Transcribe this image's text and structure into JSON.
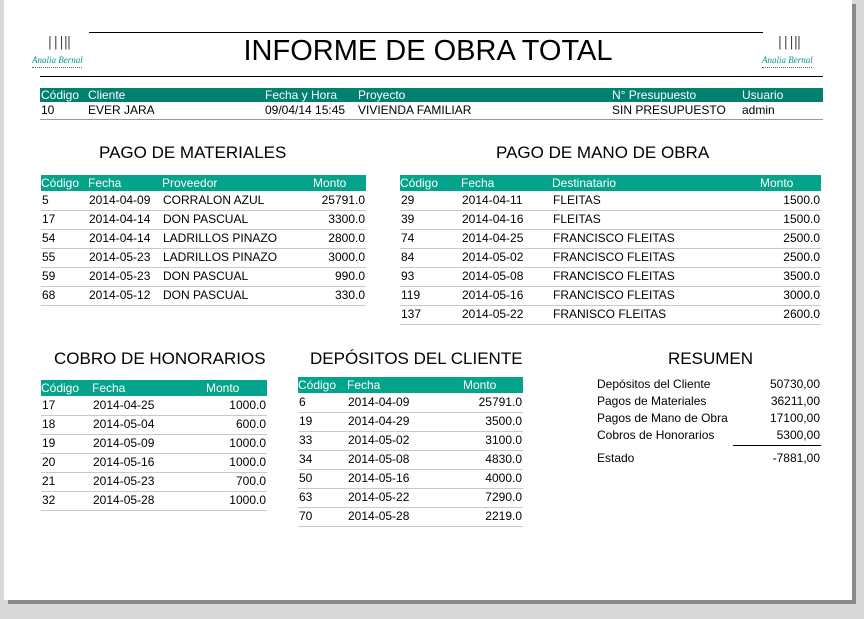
{
  "report": {
    "title": "INFORME DE OBRA TOTAL",
    "logo_text": "Analia Bernal"
  },
  "header": {
    "columns": [
      "Código",
      "Cliente",
      "Fecha y Hora",
      "Proyecto",
      "N° Presupuesto",
      "Usuario"
    ],
    "values": [
      "10",
      "EVER JARA",
      "09/04/14 15:45",
      "VIVIENDA FAMILIAR",
      "SIN PRESUPUESTO",
      "admin"
    ]
  },
  "materiales": {
    "title": "PAGO DE MATERIALES",
    "columns": [
      "Código",
      "Fecha",
      "Proveedor",
      "Monto"
    ],
    "rows": [
      [
        "5",
        "2014-04-09",
        "CORRALON AZUL",
        "25791.0"
      ],
      [
        "17",
        "2014-04-14",
        "DON PASCUAL",
        "3300.0"
      ],
      [
        "54",
        "2014-04-14",
        "LADRILLOS PINAZO",
        "2800.0"
      ],
      [
        "55",
        "2014-05-23",
        "LADRILLOS PINAZO",
        "3000.0"
      ],
      [
        "59",
        "2014-05-23",
        "DON PASCUAL",
        "990.0"
      ],
      [
        "68",
        "2014-05-12",
        "DON PASCUAL",
        "330.0"
      ]
    ]
  },
  "mano_obra": {
    "title": "PAGO DE MANO DE OBRA",
    "columns": [
      "Código",
      "Fecha",
      "Destinatario",
      "Monto"
    ],
    "rows": [
      [
        "29",
        "2014-04-11",
        "FLEITAS",
        "1500.0"
      ],
      [
        "39",
        "2014-04-16",
        "FLEITAS",
        "1500.0"
      ],
      [
        "74",
        "2014-04-25",
        "FRANCISCO FLEITAS",
        "2500.0"
      ],
      [
        "84",
        "2014-05-02",
        "FRANCISCO FLEITAS",
        "2500.0"
      ],
      [
        "93",
        "2014-05-08",
        "FRANCISCO FLEITAS",
        "3500.0"
      ],
      [
        "119",
        "2014-05-16",
        "FRANCISCO FLEITAS",
        "3000.0"
      ],
      [
        "137",
        "2014-05-22",
        "FRANISCO FLEITAS",
        "2600.0"
      ]
    ]
  },
  "honorarios": {
    "title": "COBRO DE HONORARIOS",
    "columns": [
      "Código",
      "Fecha",
      "Monto"
    ],
    "rows": [
      [
        "17",
        "2014-04-25",
        "1000.0"
      ],
      [
        "18",
        "2014-05-04",
        "600.0"
      ],
      [
        "19",
        "2014-05-09",
        "1000.0"
      ],
      [
        "20",
        "2014-05-16",
        "1000.0"
      ],
      [
        "21",
        "2014-05-23",
        "700.0"
      ],
      [
        "32",
        "2014-05-28",
        "1000.0"
      ]
    ]
  },
  "depositos": {
    "title": "DEPÓSITOS DEL CLIENTE",
    "columns": [
      "Código",
      "Fecha",
      "Monto"
    ],
    "rows": [
      [
        "6",
        "2014-04-09",
        "25791.0"
      ],
      [
        "19",
        "2014-04-29",
        "3500.0"
      ],
      [
        "33",
        "2014-05-02",
        "3100.0"
      ],
      [
        "34",
        "2014-05-08",
        "4830.0"
      ],
      [
        "50",
        "2014-05-16",
        "4000.0"
      ],
      [
        "63",
        "2014-05-22",
        "7290.0"
      ],
      [
        "70",
        "2014-05-28",
        "2219.0"
      ]
    ]
  },
  "resumen": {
    "title": "RESUMEN",
    "items": [
      {
        "label": "Depósitos del Cliente",
        "value": "50730,00"
      },
      {
        "label": "Pagos de Materiales",
        "value": "36211,00"
      },
      {
        "label": "Pagos de Mano de Obra",
        "value": "17100,00"
      },
      {
        "label": "Cobros de Honorarios",
        "value": "5300,00"
      }
    ],
    "estado_label": "Estado",
    "estado_value": "-7881,00"
  },
  "colors": {
    "header_bar": "#00806e",
    "table_bar": "#03a48b",
    "logo": "#009a84"
  }
}
